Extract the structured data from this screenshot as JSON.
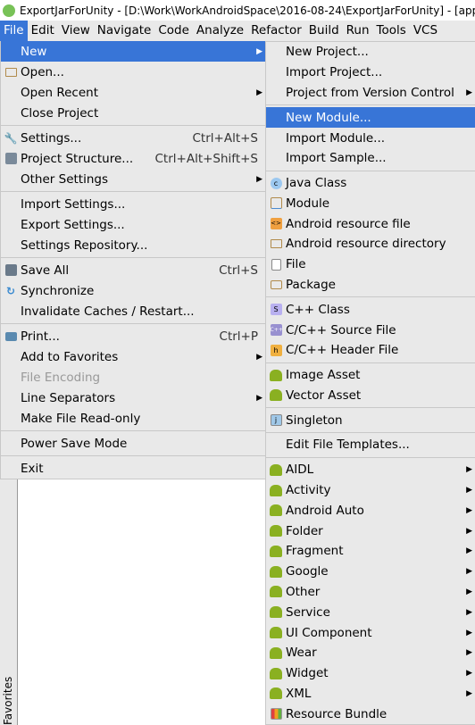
{
  "title": "ExportJarForUnity - [D:\\Work\\WorkAndroidSpace\\2016-08-24\\ExportJarForUnity] - [app]",
  "menubar": [
    "File",
    "Edit",
    "View",
    "Navigate",
    "Code",
    "Analyze",
    "Refactor",
    "Build",
    "Run",
    "Tools",
    "VCS"
  ],
  "side_tab": "Favorites",
  "file_menu": [
    {
      "label": "New",
      "submenu": true,
      "highlighted": true
    },
    {
      "label": "Open...",
      "icon": "folder-icon"
    },
    {
      "label": "Open Recent",
      "submenu": true
    },
    {
      "label": "Close Project"
    },
    {
      "sep": true
    },
    {
      "label": "Settings...",
      "icon": "wrench-icon",
      "shortcut": "Ctrl+Alt+S"
    },
    {
      "label": "Project Structure...",
      "icon": "project-structure-icon",
      "shortcut": "Ctrl+Alt+Shift+S"
    },
    {
      "label": "Other Settings",
      "submenu": true
    },
    {
      "sep": true
    },
    {
      "label": "Import Settings..."
    },
    {
      "label": "Export Settings..."
    },
    {
      "label": "Settings Repository..."
    },
    {
      "sep": true
    },
    {
      "label": "Save All",
      "icon": "save-icon",
      "shortcut": "Ctrl+S"
    },
    {
      "label": "Synchronize",
      "icon": "sync-icon"
    },
    {
      "label": "Invalidate Caches / Restart..."
    },
    {
      "sep": true
    },
    {
      "label": "Print...",
      "icon": "print-icon",
      "shortcut": "Ctrl+P"
    },
    {
      "label": "Add to Favorites",
      "submenu": true
    },
    {
      "label": "File Encoding",
      "disabled": true
    },
    {
      "label": "Line Separators",
      "submenu": true
    },
    {
      "label": "Make File Read-only"
    },
    {
      "sep": true
    },
    {
      "label": "Power Save Mode"
    },
    {
      "sep": true
    },
    {
      "label": "Exit"
    }
  ],
  "new_menu": [
    {
      "label": "New Project..."
    },
    {
      "label": "Import Project..."
    },
    {
      "label": "Project from Version Control",
      "submenu": true
    },
    {
      "sep": true
    },
    {
      "label": "New Module...",
      "highlighted": true
    },
    {
      "label": "Import Module..."
    },
    {
      "label": "Import Sample..."
    },
    {
      "sep": true
    },
    {
      "label": "Java Class",
      "icon": "java-class-icon"
    },
    {
      "label": "Module",
      "icon": "module-icon"
    },
    {
      "label": "Android resource file",
      "icon": "resource-file-icon"
    },
    {
      "label": "Android resource directory",
      "icon": "folder-icon"
    },
    {
      "label": "File",
      "icon": "file-icon"
    },
    {
      "label": "Package",
      "icon": "package-icon"
    },
    {
      "sep": true
    },
    {
      "label": "C++ Class",
      "icon": "cpp-class-icon"
    },
    {
      "label": "C/C++ Source File",
      "icon": "cpp-source-icon"
    },
    {
      "label": "C/C++ Header File",
      "icon": "header-file-icon"
    },
    {
      "sep": true
    },
    {
      "label": "Image Asset",
      "icon": "android-icon"
    },
    {
      "label": "Vector Asset",
      "icon": "android-icon"
    },
    {
      "sep": true
    },
    {
      "label": "Singleton",
      "icon": "singleton-icon"
    },
    {
      "sep": true
    },
    {
      "label": "Edit File Templates..."
    },
    {
      "sep": true
    },
    {
      "label": "AIDL",
      "icon": "android-icon",
      "submenu": true
    },
    {
      "label": "Activity",
      "icon": "android-icon",
      "submenu": true
    },
    {
      "label": "Android Auto",
      "icon": "android-icon",
      "submenu": true
    },
    {
      "label": "Folder",
      "icon": "android-icon",
      "submenu": true
    },
    {
      "label": "Fragment",
      "icon": "android-icon",
      "submenu": true
    },
    {
      "label": "Google",
      "icon": "android-icon",
      "submenu": true
    },
    {
      "label": "Other",
      "icon": "android-icon",
      "submenu": true
    },
    {
      "label": "Service",
      "icon": "android-icon",
      "submenu": true
    },
    {
      "label": "UI Component",
      "icon": "android-icon",
      "submenu": true
    },
    {
      "label": "Wear",
      "icon": "android-icon",
      "submenu": true
    },
    {
      "label": "Widget",
      "icon": "android-icon",
      "submenu": true
    },
    {
      "label": "XML",
      "icon": "android-icon",
      "submenu": true
    },
    {
      "label": "Resource Bundle",
      "icon": "resource-bundle-icon"
    }
  ],
  "colors": {
    "highlight": "#3875d7",
    "menu_bg": "#e9e9e9",
    "android": "#8ab021"
  }
}
